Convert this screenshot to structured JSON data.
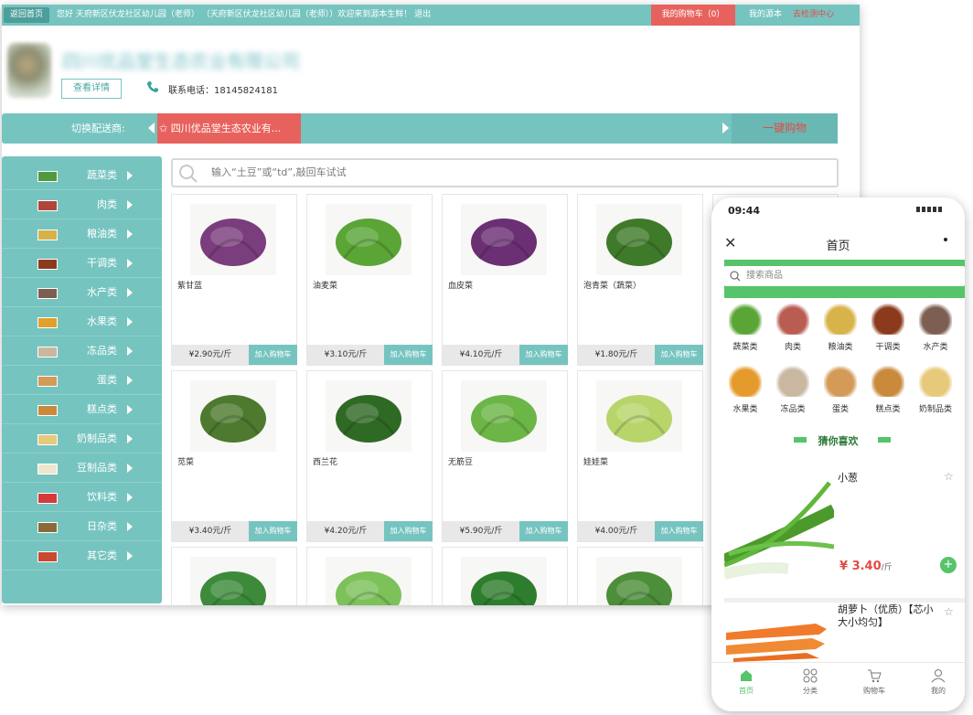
{
  "topbar": {
    "back_label": "返回首页",
    "greeting": "您好 天府新区伏龙社区幼儿园（老师） （天府新区伏龙社区幼儿园（老师））欢迎来到源本生鲜！ 退出",
    "cart_label": "我的购物车（0）",
    "my_source": "我的源本",
    "check_center": "去检测中心"
  },
  "company": {
    "name": "四川优品堂生态农业有限公司",
    "detail_button": "查看详情",
    "phone_label": "联系电话：18145824181"
  },
  "supplier": {
    "switch_label": "切换配送商:",
    "current": "✩ 四川优品堂生态农业有...",
    "one_key_buy": "一键购物"
  },
  "search": {
    "placeholder": "输入“土豆”或“td”,敲回车试试"
  },
  "categories": [
    {
      "label": "蔬菜类",
      "color": "#4f9a3c"
    },
    {
      "label": "肉类",
      "color": "#b0463a"
    },
    {
      "label": "粮油类",
      "color": "#d7b24a"
    },
    {
      "label": "干调类",
      "color": "#8c3a1e"
    },
    {
      "label": "水产类",
      "color": "#7d5e52"
    },
    {
      "label": "水果类",
      "color": "#e0a02c"
    },
    {
      "label": "冻品类",
      "color": "#c9b7a0"
    },
    {
      "label": "蛋类",
      "color": "#d49a58"
    },
    {
      "label": "糕点类",
      "color": "#c98a3c"
    },
    {
      "label": "奶制品类",
      "color": "#e6c97a"
    },
    {
      "label": "豆制品类",
      "color": "#efe6cf"
    },
    {
      "label": "饮料类",
      "color": "#d53a3a"
    },
    {
      "label": "日杂类",
      "color": "#8a6a3a"
    },
    {
      "label": "其它类",
      "color": "#c84a30"
    }
  ],
  "add_to_cart_label": "加入购物车",
  "products": [
    {
      "name": "紫甘蓝",
      "price": "¥2.90元/斤",
      "color": "#7a3d7d"
    },
    {
      "name": "油麦菜",
      "price": "¥3.10元/斤",
      "color": "#5aa536"
    },
    {
      "name": "血皮菜",
      "price": "¥4.10元/斤",
      "color": "#6b2f74"
    },
    {
      "name": "泡青菜（蔬菜）",
      "price": "¥1.80元/斤",
      "color": "#3f7a2a"
    },
    {
      "name": "苋菜",
      "price": "¥3.40元/斤",
      "color": "#4d7a2e"
    },
    {
      "name": "西兰花",
      "price": "¥4.20元/斤",
      "color": "#2f6a24"
    },
    {
      "name": "无筋豆",
      "price": "¥5.90元/斤",
      "color": "#6cb547"
    },
    {
      "name": "娃娃菜",
      "price": "¥4.00元/斤",
      "color": "#b7d56a"
    },
    {
      "name": "",
      "price": "",
      "color": "#3c8a3a"
    },
    {
      "name": "",
      "price": "",
      "color": "#7cc15a"
    },
    {
      "name": "",
      "price": "",
      "color": "#2e7d2e"
    },
    {
      "name": "",
      "price": "",
      "color": "#4d8e3a"
    }
  ],
  "phone": {
    "time": "09:44",
    "title": "首页",
    "search_placeholder": "搜索商品",
    "categories": [
      {
        "label": "蔬菜类",
        "color": "#5aa536"
      },
      {
        "label": "肉类",
        "color": "#b95c52"
      },
      {
        "label": "粮油类",
        "color": "#d8b24a"
      },
      {
        "label": "干调类",
        "color": "#8c3a1e"
      },
      {
        "label": "水产类",
        "color": "#7d5e52"
      },
      {
        "label": "水果类",
        "color": "#e59a2c"
      },
      {
        "label": "冻品类",
        "color": "#c9b7a0"
      },
      {
        "label": "蛋类",
        "color": "#d49a58"
      },
      {
        "label": "糕点类",
        "color": "#c98a3c"
      },
      {
        "label": "奶制品类",
        "color": "#e6c97a"
      }
    ],
    "guess_title": "猜你喜欢",
    "item1": {
      "name": "小葱",
      "price": "¥ 3.40",
      "unit": "/斤"
    },
    "item2": {
      "name": "胡萝卜（优质）【芯小 大小均匀】"
    },
    "tabs": [
      "首页",
      "分类",
      "购物车",
      "我的"
    ],
    "accent": "#56c46a"
  }
}
